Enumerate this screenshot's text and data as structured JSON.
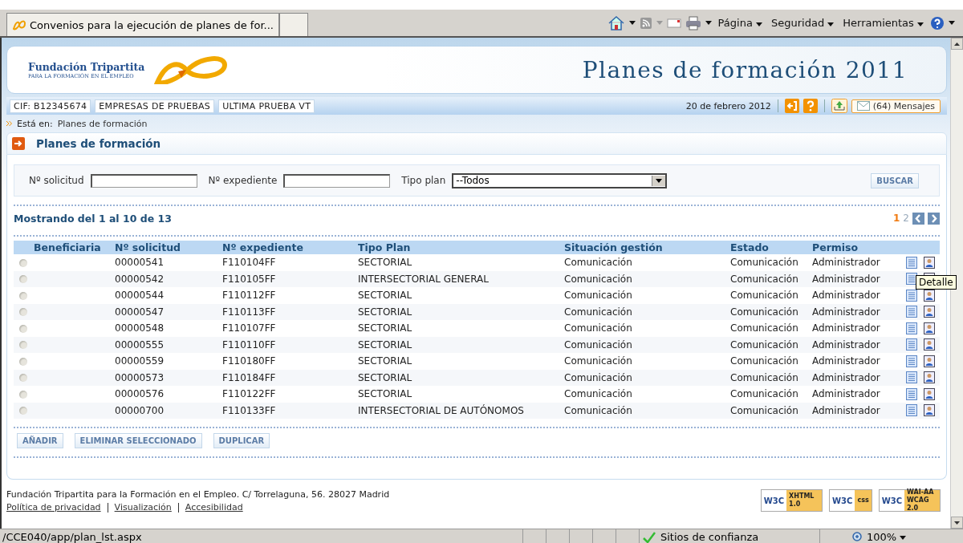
{
  "browser": {
    "tab_title": "Convenios para la ejecución de planes de for...",
    "menus": [
      "Página",
      "Seguridad",
      "Herramientas"
    ]
  },
  "header": {
    "org_name": "Fundación Tripartita",
    "org_tagline": "PARA LA FORMACIÓN EN EL EMPLEO",
    "title": "Planes de formación 2011"
  },
  "info_bar": {
    "tags": [
      "CIF: B12345674",
      "EMPRESAS DE PRUEBAS",
      "ULTIMA PRUEBA VT"
    ],
    "date": "20 de febrero 2012",
    "messages": "(64) Mensajes"
  },
  "breadcrumb": {
    "label": "Está en:",
    "path": "Planes de formación"
  },
  "page_title": "Planes de formación",
  "filters": [
    {
      "label": "Nº solicitud",
      "kind": "text"
    },
    {
      "label": "Nº expediente",
      "kind": "text"
    },
    {
      "label": "Tipo plan",
      "kind": "select",
      "value": "--Todos"
    }
  ],
  "search_button": "BUSCAR",
  "results": {
    "summary": "Mostrando del 1 al 10 de 13",
    "pages": [
      {
        "label": "1",
        "selected": true
      },
      {
        "label": "2",
        "selected": false
      }
    ]
  },
  "table": {
    "columns": [
      "Beneficiaria",
      "Nº solicitud",
      "Nº expediente",
      "Tipo Plan",
      "Situación gestión",
      "Estado",
      "Permiso"
    ],
    "rows": [
      {
        "selected": false,
        "cells": [
          "",
          "00000541",
          "F110104FF",
          "SECTORIAL",
          "Comunicación",
          "Comunicación",
          "Administrador"
        ]
      },
      {
        "selected": false,
        "cells": [
          "",
          "00000542",
          "F110105FF",
          "INTERSECTORIAL GENERAL",
          "Comunicación",
          "Comunicación",
          "Administrador"
        ]
      },
      {
        "selected": false,
        "cells": [
          "",
          "00000544",
          "F110112FF",
          "SECTORIAL",
          "Comunicación",
          "Comunicación",
          "Administrador"
        ]
      },
      {
        "selected": false,
        "cells": [
          "",
          "00000547",
          "F110113FF",
          "SECTORIAL",
          "Comunicación",
          "Comunicación",
          "Administrador"
        ]
      },
      {
        "selected": false,
        "cells": [
          "",
          "00000548",
          "F110107FF",
          "SECTORIAL",
          "Comunicación",
          "Comunicación",
          "Administrador"
        ]
      },
      {
        "selected": false,
        "cells": [
          "",
          "00000555",
          "F110110FF",
          "SECTORIAL",
          "Comunicación",
          "Comunicación",
          "Administrador"
        ]
      },
      {
        "selected": false,
        "cells": [
          "",
          "00000559",
          "F110180FF",
          "SECTORIAL",
          "Comunicación",
          "Comunicación",
          "Administrador"
        ]
      },
      {
        "selected": false,
        "cells": [
          "",
          "00000573",
          "F110184FF",
          "SECTORIAL",
          "Comunicación",
          "Comunicación",
          "Administrador"
        ]
      },
      {
        "selected": false,
        "cells": [
          "",
          "00000576",
          "F110122FF",
          "SECTORIAL",
          "Comunicación",
          "Comunicación",
          "Administrador"
        ]
      },
      {
        "selected": false,
        "cells": [
          "",
          "00000700",
          "F110133FF",
          "INTERSECTORIAL DE AUTÓNOMOS",
          "Comunicación",
          "Comunicación",
          "Administrador"
        ]
      }
    ]
  },
  "tooltip": "Detalle",
  "actions": [
    "AÑADIR",
    "ELIMINAR SELECCIONADO",
    "DUPLICAR"
  ],
  "footer": {
    "address": "Fundación Tripartita para la Formación en el Empleo. C/ Torrelaguna, 56. 28027 Madrid",
    "links": [
      "Política de privacidad",
      "Visualización",
      "Accesibilidad"
    ],
    "badges": [
      {
        "left": "W3C",
        "right": "XHTML 1.0"
      },
      {
        "left": "W3C",
        "right": "css"
      },
      {
        "left": "W3C",
        "right": "WAI-AA WCAG 2.0"
      }
    ]
  },
  "status_bar": {
    "url": "/CCE040/app/plan_lst.aspx",
    "zone": "Sitios de confianza",
    "zoom": "100%"
  }
}
